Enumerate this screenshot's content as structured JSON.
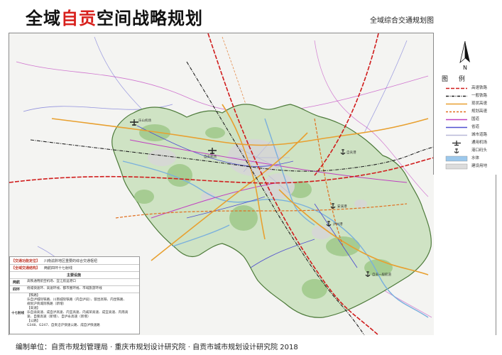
{
  "header": {
    "title_part1": "全域",
    "title_accent": "自贡",
    "title_part2": "空间战略规划",
    "subtitle": "全域综合交通规划图"
  },
  "legend": {
    "title": "图  例",
    "items": [
      {
        "label": "高速铁路",
        "icon": "high-speed-rail-line",
        "color": "#d01c1c"
      },
      {
        "label": "一般铁路",
        "icon": "railway-line",
        "color": "#222222"
      },
      {
        "label": "现状高速",
        "icon": "existing-expressway-line",
        "color": "#e8a030"
      },
      {
        "label": "规划高速",
        "icon": "planned-expressway-line",
        "color": "#e07020"
      },
      {
        "label": "国道",
        "icon": "national-road-line",
        "color": "#c040c0"
      },
      {
        "label": "省道",
        "icon": "provincial-road-line",
        "color": "#5050d0"
      },
      {
        "label": "城市道路",
        "icon": "urban-road-line",
        "color": "#b8b8d8"
      },
      {
        "label": "通用机场",
        "icon": "airport-icon",
        "color": "#222222"
      },
      {
        "label": "港口码头",
        "icon": "anchor-icon",
        "color": "#222222"
      },
      {
        "label": "水体",
        "icon": "water-fill",
        "color": "#9cc8ec"
      },
      {
        "label": "建设用地",
        "icon": "built-land-fill",
        "color": "#dcdcdc"
      }
    ]
  },
  "info": {
    "row1_key": "【交通功能定位】",
    "row1_val": "川南渝黔地区重要的综合交通枢纽",
    "row2_key": "【全域交通结构】",
    "row2_val": "两航四环十七射线",
    "table_header": "主要设施",
    "table": [
      {
        "label": "两航",
        "text": [
          "高铁通用航空机场、宜江航运港口"
        ]
      },
      {
        "label": "四环",
        "text": [
          "绕城快速环、高速环线、都市圈环线、市域旅游环线"
        ]
      },
      {
        "label": "十七射线",
        "text": [
          "【铁路】",
          "乐自泸城际铁路、川南城际铁路（内自泸段）、蓉昆高铁、内昆铁路、",
          "规划沪贡城际铁路（新增）",
          "【高速】",
          "乐自渝高速、成自泸高速、内宜高速、内威荣高速、成宜高速、内南高",
          "速、自隆高速（新增）、自泸永高速（新增）",
          "【公路】",
          "G348、G247、自贡沿沪快速公路、成自泸快速路"
        ]
      }
    ]
  },
  "map": {
    "colors": {
      "land": "#f4f4f2",
      "region": "#cfe3c4",
      "region_stroke": "#4d7a3a",
      "forest": "#9fc98a",
      "built": "#d6d6d6",
      "water": "#7ab0dd",
      "hsr": "#d01c1c",
      "rail": "#222222",
      "expressway": "#e8a030",
      "planned": "#e07020",
      "national": "#c040c0",
      "provincial": "#5050d0",
      "urban": "#b8b8d8"
    },
    "place_labels": [
      "乐山机场",
      "自贡机场",
      "自贡港",
      "安溪港",
      "泸州港",
      "自贡一般航道"
    ]
  },
  "footer": {
    "text": "编制单位：自贡市规划管理局 · 重庆市规划设计研究院 · 自贡市城市规划设计研究院 2018"
  }
}
